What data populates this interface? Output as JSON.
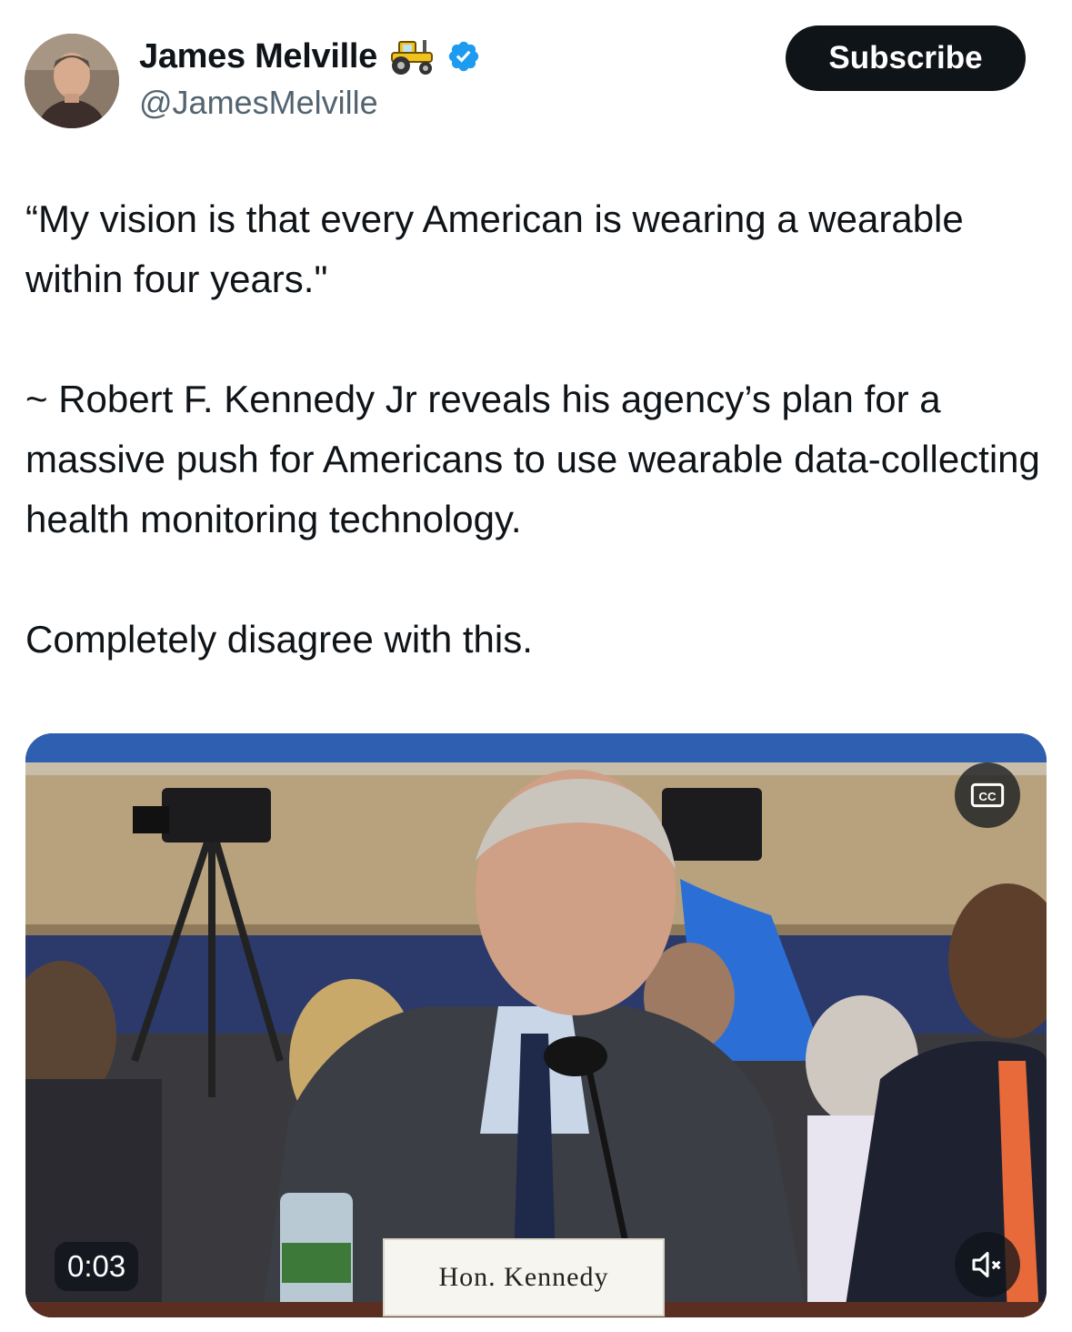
{
  "author": {
    "display_name": "James Melville",
    "handle": "@JamesMelville",
    "badge_emoji": "tractor-icon",
    "verified": true
  },
  "subscribe_label": "Subscribe",
  "tweet": {
    "paragraph_1": "“My vision is that every American is wearing a wearable within four years.\"",
    "paragraph_2": "~ Robert F. Kennedy Jr reveals his agency’s plan for a massive push for Americans to use wearable data-collecting health monitoring technology.",
    "paragraph_3": "Completely disagree with this."
  },
  "video": {
    "elapsed": "0:03",
    "nameplate": "Hon. Kennedy",
    "captions_icon": "cc-icon",
    "mute_icon": "volume-muted-icon"
  },
  "colors": {
    "text": "#0f1419",
    "secondary_text": "#536471",
    "verified_blue": "#1d9bf0",
    "button_bg": "#0f1419"
  }
}
